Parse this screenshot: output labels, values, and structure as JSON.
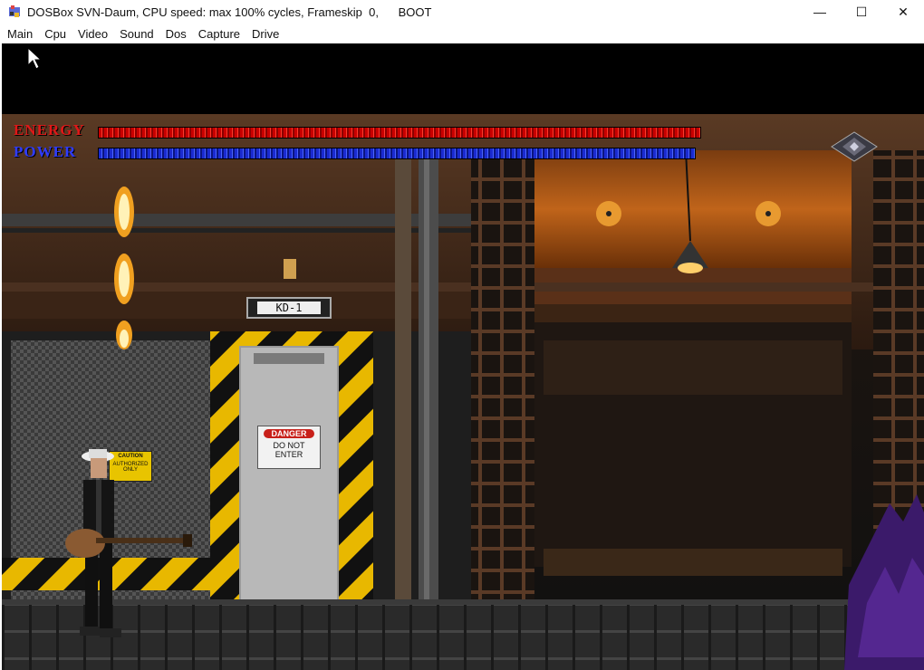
{
  "window": {
    "title": "DOSBox SVN-Daum, CPU speed: max 100% cycles, Frameskip  0,      BOOT",
    "controls": {
      "minimize": "—",
      "maximize": "☐",
      "close": "✕"
    }
  },
  "menu": {
    "items": [
      "Main",
      "Cpu",
      "Video",
      "Sound",
      "Dos",
      "Capture",
      "Drive"
    ]
  },
  "hud": {
    "energy_label": "ENERGY",
    "power_label": "POWER",
    "energy_level": 1.0,
    "power_level": 1.0,
    "colors": {
      "energy": "#e01818",
      "power": "#2f3cff"
    }
  },
  "scene": {
    "door_sign": "KD-1",
    "danger_sign": {
      "header": "DANGER",
      "line1": "DO NOT",
      "line2": "ENTER"
    },
    "caution_sign": {
      "header": "CAUTION",
      "line1": "AUTHORIZED",
      "line2": "ONLY"
    },
    "icons": [
      "player-guitarist",
      "purple-creature",
      "crystal-gem-icon",
      "fire-column",
      "ceiling-lamp"
    ]
  }
}
